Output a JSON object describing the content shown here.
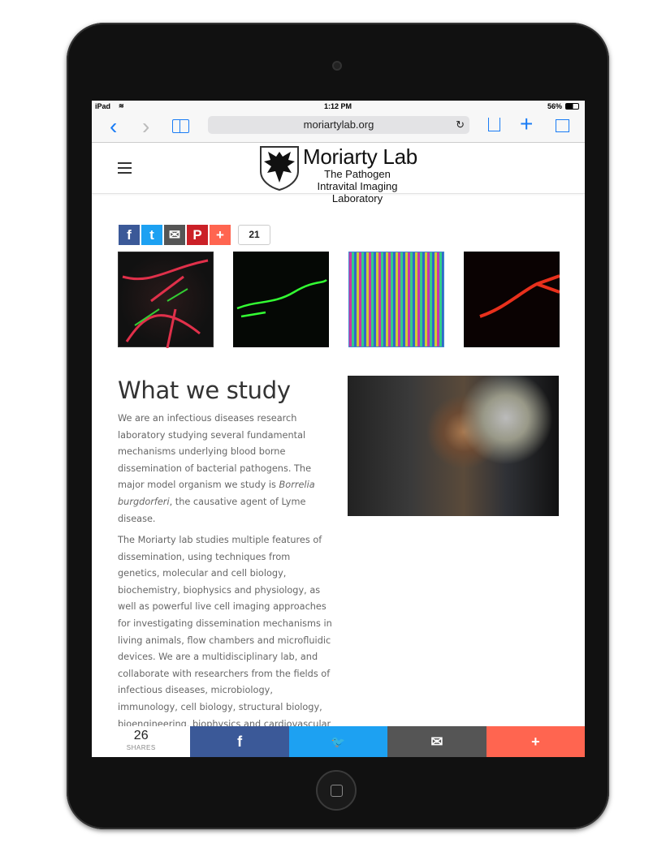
{
  "status": {
    "device": "iPad",
    "time": "1:12 PM",
    "battery": "56%"
  },
  "browser": {
    "url": "moriartylab.org",
    "back_icon": "‹",
    "forward_icon": "›",
    "bookmarks_icon": "book-icon",
    "reload_icon": "↻",
    "share_icon": "share-icon",
    "add_icon": "+",
    "tabs_icon": "tabs-icon"
  },
  "header": {
    "title": "Moriarty Lab",
    "subtitle": "The Pathogen Intravital Imaging Laboratory"
  },
  "share_top": {
    "buttons": [
      {
        "icon": "f",
        "color": "#3b5998"
      },
      {
        "icon": "t",
        "color": "#1da1f2"
      },
      {
        "icon": "✉",
        "color": "#555555"
      },
      {
        "icon": "P",
        "color": "#cb2027"
      },
      {
        "icon": "+",
        "color": "#ff6550"
      }
    ],
    "count": "21"
  },
  "main": {
    "heading": "What we study",
    "para1_a": "We are an infectious diseases research laboratory studying several fundamental mechanisms underlying blood borne dissemination of bacterial pathogens. The major model organism we study is ",
    "para1_em": "Borrelia burgdorferi",
    "para1_b": ", the causative agent of Lyme disease.",
    "para2": "The Moriarty lab studies multiple features of dissemination, using techniques from genetics, molecular and cell biology, biochemistry, biophysics and physiology, as well as powerful live cell imaging approaches for investigating dissemination mechanisms in living animals, flow chambers and microfluidic devices. We are a multidisciplinary lab, and collaborate with researchers from the fields of infectious diseases, microbiology, immunology, cell biology, structural biology, bioengineering, biophysics and cardiovascular biology. Our lab has also recently"
  },
  "share_bar": {
    "count": "26",
    "label": "SHARES",
    "facebook": "f",
    "twitter": "🐦",
    "email": "✉",
    "more": "+",
    "colors": {
      "facebook": "#3b5998",
      "twitter": "#1da1f2",
      "email": "#555555",
      "more": "#ff6550"
    }
  }
}
